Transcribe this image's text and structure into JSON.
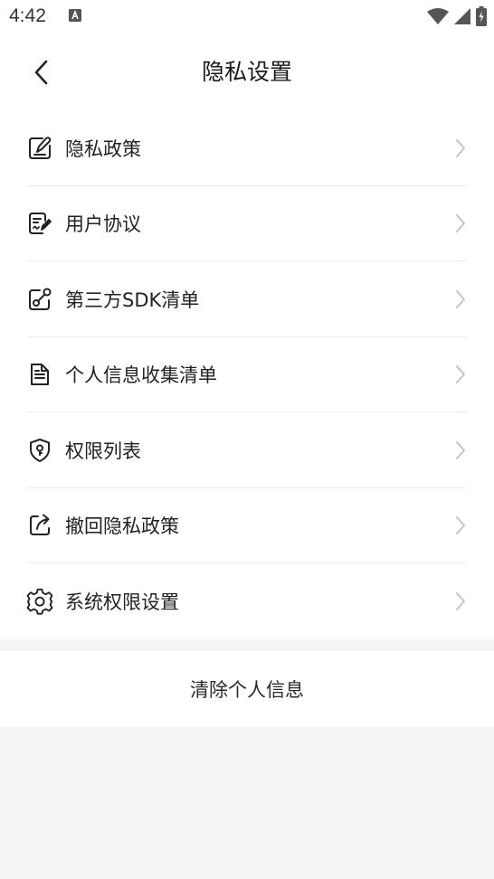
{
  "status_bar": {
    "time": "4:42",
    "icons": [
      "a-notification-icon",
      "wifi-icon",
      "signal-icon",
      "battery-icon"
    ]
  },
  "header": {
    "title": "隐私设置",
    "back_icon": "chevron-left-icon"
  },
  "menu": {
    "items": [
      {
        "label": "隐私政策",
        "icon": "edit-note-icon"
      },
      {
        "label": "用户协议",
        "icon": "document-edit-icon"
      },
      {
        "label": "第三方SDK清单",
        "icon": "link-nodes-icon"
      },
      {
        "label": "个人信息收集清单",
        "icon": "document-list-icon"
      },
      {
        "label": "权限列表",
        "icon": "shield-key-icon"
      },
      {
        "label": "撤回隐私政策",
        "icon": "share-out-icon"
      },
      {
        "label": "系统权限设置",
        "icon": "gear-icon"
      }
    ]
  },
  "actions": {
    "clear_personal_info": "清除个人信息"
  },
  "colors": {
    "background": "#f4f4f4",
    "surface": "#ffffff",
    "divider": "#ececec",
    "text": "#222222",
    "chevron": "#c4c4c4"
  }
}
